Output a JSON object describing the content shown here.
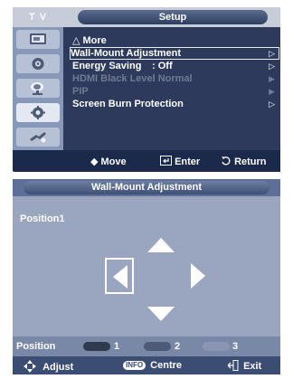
{
  "setup_menu": {
    "source_tab": "T V",
    "title": "Setup",
    "side_icons": [
      "picture-icon",
      "sound-icon",
      "channel-icon",
      "setup-icon",
      "input-icon"
    ],
    "items": [
      {
        "label": "△ More",
        "value": "",
        "arrow": ""
      },
      {
        "label": "Wall-Mount Adjustment",
        "value": "",
        "arrow": "▷"
      },
      {
        "label": "Energy Saving",
        "value": ": Off",
        "arrow": "▷"
      },
      {
        "label": "HDMI Black Level",
        "value": ": Normal",
        "arrow": "▶"
      },
      {
        "label": "PIP",
        "value": "",
        "arrow": "▶"
      },
      {
        "label": "Screen Burn Protection",
        "value": "",
        "arrow": "▷"
      }
    ],
    "footer": {
      "move": "◆ Move",
      "enter": "Enter",
      "return": "Return"
    }
  },
  "wall_mount": {
    "title": "Wall-Mount Adjustment",
    "position_label": "Position1",
    "position_bar": {
      "label": "Position",
      "slots": [
        "1",
        "2",
        "3"
      ]
    },
    "footer": {
      "adjust": "Adjust",
      "info": "INFO",
      "centre": "Centre",
      "exit": "Exit"
    }
  },
  "colors": {
    "slot1": "#2f3a4f",
    "slot2": "#4e5b78",
    "slot3": "#8a96b1"
  }
}
